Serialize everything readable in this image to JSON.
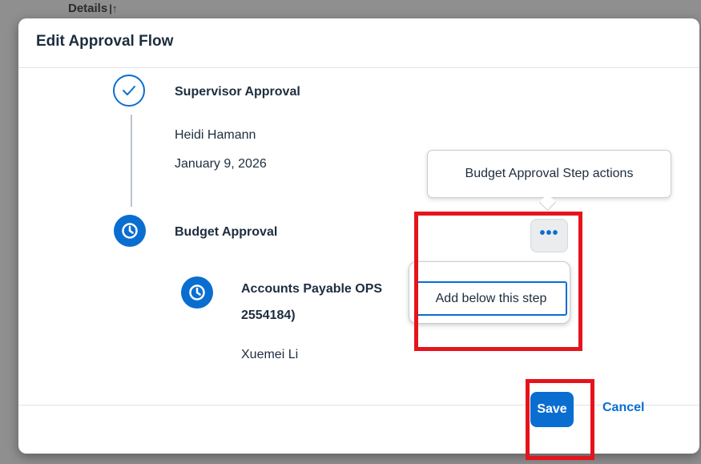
{
  "background": {
    "column_header": "Details",
    "sort_icon": "sort-ascending-icon"
  },
  "dialog": {
    "title": "Edit Approval Flow",
    "steps": [
      {
        "icon": "check-icon",
        "title": "Supervisor Approval",
        "approver": "Heidi Hamann",
        "date": "January 9, 2026"
      },
      {
        "icon": "clock-icon",
        "title": "Budget Approval",
        "substep": {
          "icon": "clock-icon",
          "title_line1": "Accounts Payable OPS",
          "title_line2": "2554184)",
          "approver": "Xuemei Li"
        }
      }
    ],
    "more_button_label": "•••",
    "tooltip": "Budget Approval Step actions",
    "menu_item": "Add below this step",
    "save_label": "Save",
    "cancel_label": "Cancel"
  },
  "colors": {
    "accent": "#0a6ed1",
    "highlight": "#e5141c"
  }
}
